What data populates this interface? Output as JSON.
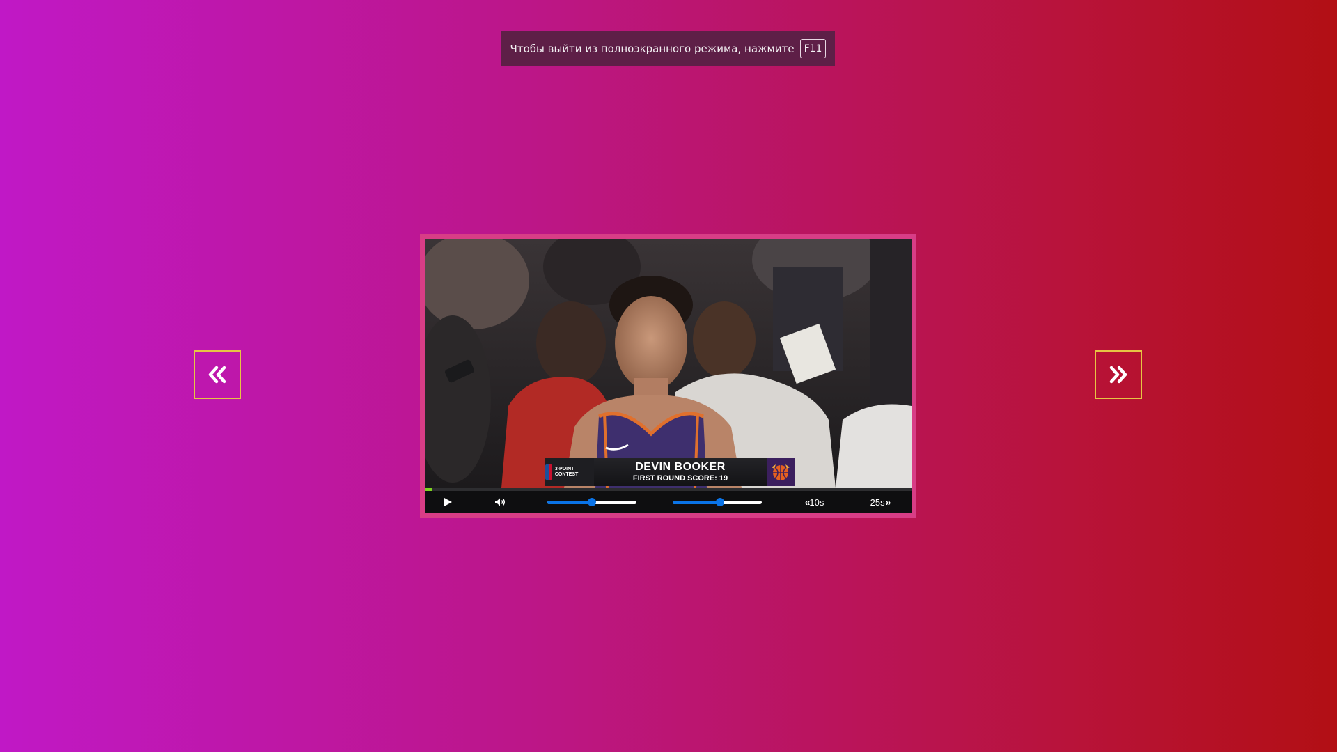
{
  "fullscreen_notice": {
    "message": "Чтобы выйти из полноэкранного режима, нажмите",
    "key": "F11"
  },
  "navigation": {
    "prev_icon": "double-chevron-left-icon",
    "next_icon": "double-chevron-right-icon",
    "border_color": "#e6c544"
  },
  "video": {
    "lower_third": {
      "contest_label": "3-POINT CONTEST",
      "name": "DEVIN BOOKER",
      "score_line": "FIRST ROUND SCORE:  19"
    },
    "progress": 0.015,
    "controls": {
      "play_icon": "play-icon",
      "volume_icon": "volume-icon",
      "volume_level": 0.5,
      "speed_level": 0.53,
      "skip_back_label": "10s",
      "skip_forward_label": "25s"
    },
    "accent_color": "#0a74e8",
    "progress_color": "#7ed321",
    "frame_color": "#d83d86"
  }
}
